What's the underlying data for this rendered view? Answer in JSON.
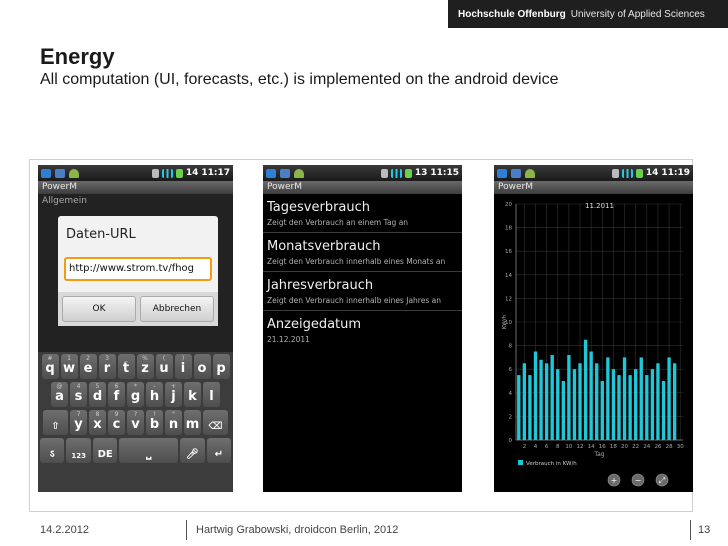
{
  "header": {
    "org": "Hochschule Offenburg",
    "university": "University of Applied Sciences"
  },
  "slide": {
    "title": "Energy",
    "subtitle": "All computation (UI, forecasts, etc.) is implemented on the android device"
  },
  "phone1": {
    "time": "11:17",
    "battery": "14",
    "app_title": "PowerM",
    "section": "Allgemein",
    "dialog": {
      "title": "Daten-URL",
      "input_value": "http://www.strom.tv/fhog",
      "ok_label": "OK",
      "cancel_label": "Abbrechen"
    },
    "keyboard": {
      "row1": [
        {
          "k": "q",
          "s": "#"
        },
        {
          "k": "w",
          "s": "1"
        },
        {
          "k": "e",
          "s": "2"
        },
        {
          "k": "r",
          "s": "3"
        },
        {
          "k": "t",
          "s": "_"
        },
        {
          "k": "z",
          "s": "%"
        },
        {
          "k": "u",
          "s": "("
        },
        {
          "k": "i",
          "s": ")"
        },
        {
          "k": "o",
          "s": ""
        },
        {
          "k": "p",
          "s": ""
        }
      ],
      "row2": [
        {
          "k": "a",
          "s": "@"
        },
        {
          "k": "s",
          "s": "4"
        },
        {
          "k": "d",
          "s": "5"
        },
        {
          "k": "f",
          "s": "6"
        },
        {
          "k": "g",
          "s": "*"
        },
        {
          "k": "h",
          "s": "-"
        },
        {
          "k": "j",
          "s": "+"
        },
        {
          "k": "k",
          "s": ""
        },
        {
          "k": "l",
          "s": ""
        }
      ],
      "row3": [
        {
          "k": "y",
          "s": "7"
        },
        {
          "k": "x",
          "s": "8"
        },
        {
          "k": "c",
          "s": "9"
        },
        {
          "k": "v",
          "s": "?"
        },
        {
          "k": "b",
          "s": "!"
        },
        {
          "k": "n",
          "s": "\""
        },
        {
          "k": "m",
          "s": ""
        }
      ],
      "sym_label": "123\nSYM",
      "lang_label": "DE"
    }
  },
  "phone2": {
    "time": "11:15",
    "battery": "13",
    "app_title": "PowerM",
    "items": [
      {
        "title": "Tagesverbrauch",
        "desc": "Zeigt den Verbrauch an einem Tag an"
      },
      {
        "title": "Monatsverbrauch",
        "desc": "Zeigt den Verbrauch innerhalb eines Monats an"
      },
      {
        "title": "Jahresverbrauch",
        "desc": "Zeigt den Verbrauch innerhalb eines Jahres an"
      },
      {
        "title": "Anzeigedatum",
        "desc": "21.12.2011"
      }
    ]
  },
  "phone3": {
    "time": "11:19",
    "battery": "14",
    "app_title": "PowerM",
    "zoom_icons": [
      "zoom-in-icon",
      "zoom-out-icon",
      "zoom-reset-icon"
    ]
  },
  "chart_data": {
    "type": "bar",
    "title": "11.2011",
    "xlabel": "Tag",
    "ylabel": "KW/h",
    "legend": "Verbrauch in KW/h",
    "x": [
      1,
      2,
      3,
      4,
      5,
      6,
      7,
      8,
      9,
      10,
      11,
      12,
      13,
      14,
      15,
      16,
      17,
      18,
      19,
      20,
      21,
      22,
      23,
      24,
      25,
      26,
      27,
      28,
      29,
      30
    ],
    "values": [
      5.5,
      6.5,
      5.5,
      7.5,
      6.8,
      6.5,
      7.2,
      6.0,
      5.0,
      7.2,
      6.0,
      6.5,
      8.5,
      7.5,
      6.5,
      5.0,
      7.0,
      6.0,
      5.5,
      7.0,
      5.5,
      6.0,
      7.0,
      5.5,
      6.0,
      6.5,
      5.0,
      7.0,
      6.5,
      0
    ],
    "ylim": [
      0,
      20
    ],
    "yticks": [
      0,
      2,
      4,
      6,
      8,
      10,
      12,
      14,
      16,
      18,
      20
    ],
    "xticks": [
      2,
      4,
      6,
      8,
      10,
      12,
      14,
      16,
      18,
      20,
      22,
      24,
      26,
      28,
      30
    ],
    "color": "#1ec8d8",
    "grid": true
  },
  "footer": {
    "date": "14.2.2012",
    "author": "Hartwig Grabowski, droidcon Berlin, 2012",
    "page": "13"
  }
}
